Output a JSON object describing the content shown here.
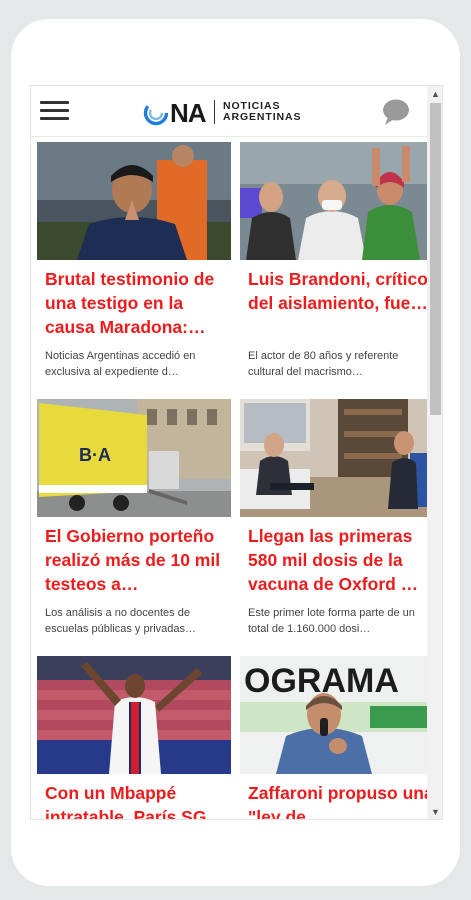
{
  "header": {
    "logo_abbrev": "NA",
    "logo_line1": "NOTICIAS",
    "logo_line2": "ARGENTINAS",
    "brand_blue": "#1f7fd6"
  },
  "theme": {
    "accent": "#ee1c1c"
  },
  "articles": [
    {
      "headline": "Brutal testimonio de una testigo en la causa Maradona:…",
      "summary": "Noticias Argentinas accedió en exclusiva al expediente d…"
    },
    {
      "headline": "Luis Brandoni, crítico del aislamiento, fue…",
      "summary": "El actor de 80 años y referente cultural del macrismo…"
    },
    {
      "headline": "El Gobierno porteño realizó más de 10 mil testeos a…",
      "summary": "Los análisis a no docentes de escuelas públicas y privadas…"
    },
    {
      "headline": "Llegan las primeras 580 mil dosis de la vacuna de Oxford …",
      "summary": "Este primer lote forma parte de un total de 1.160.000 dosi…"
    },
    {
      "headline": "Con un Mbappé intratable, París SG",
      "summary": ""
    },
    {
      "headline": "Zaffaroni propuso una \"ley de",
      "summary": ""
    }
  ],
  "images": {
    "truck_text": "B·A",
    "banner_text": "OGRAMA"
  }
}
